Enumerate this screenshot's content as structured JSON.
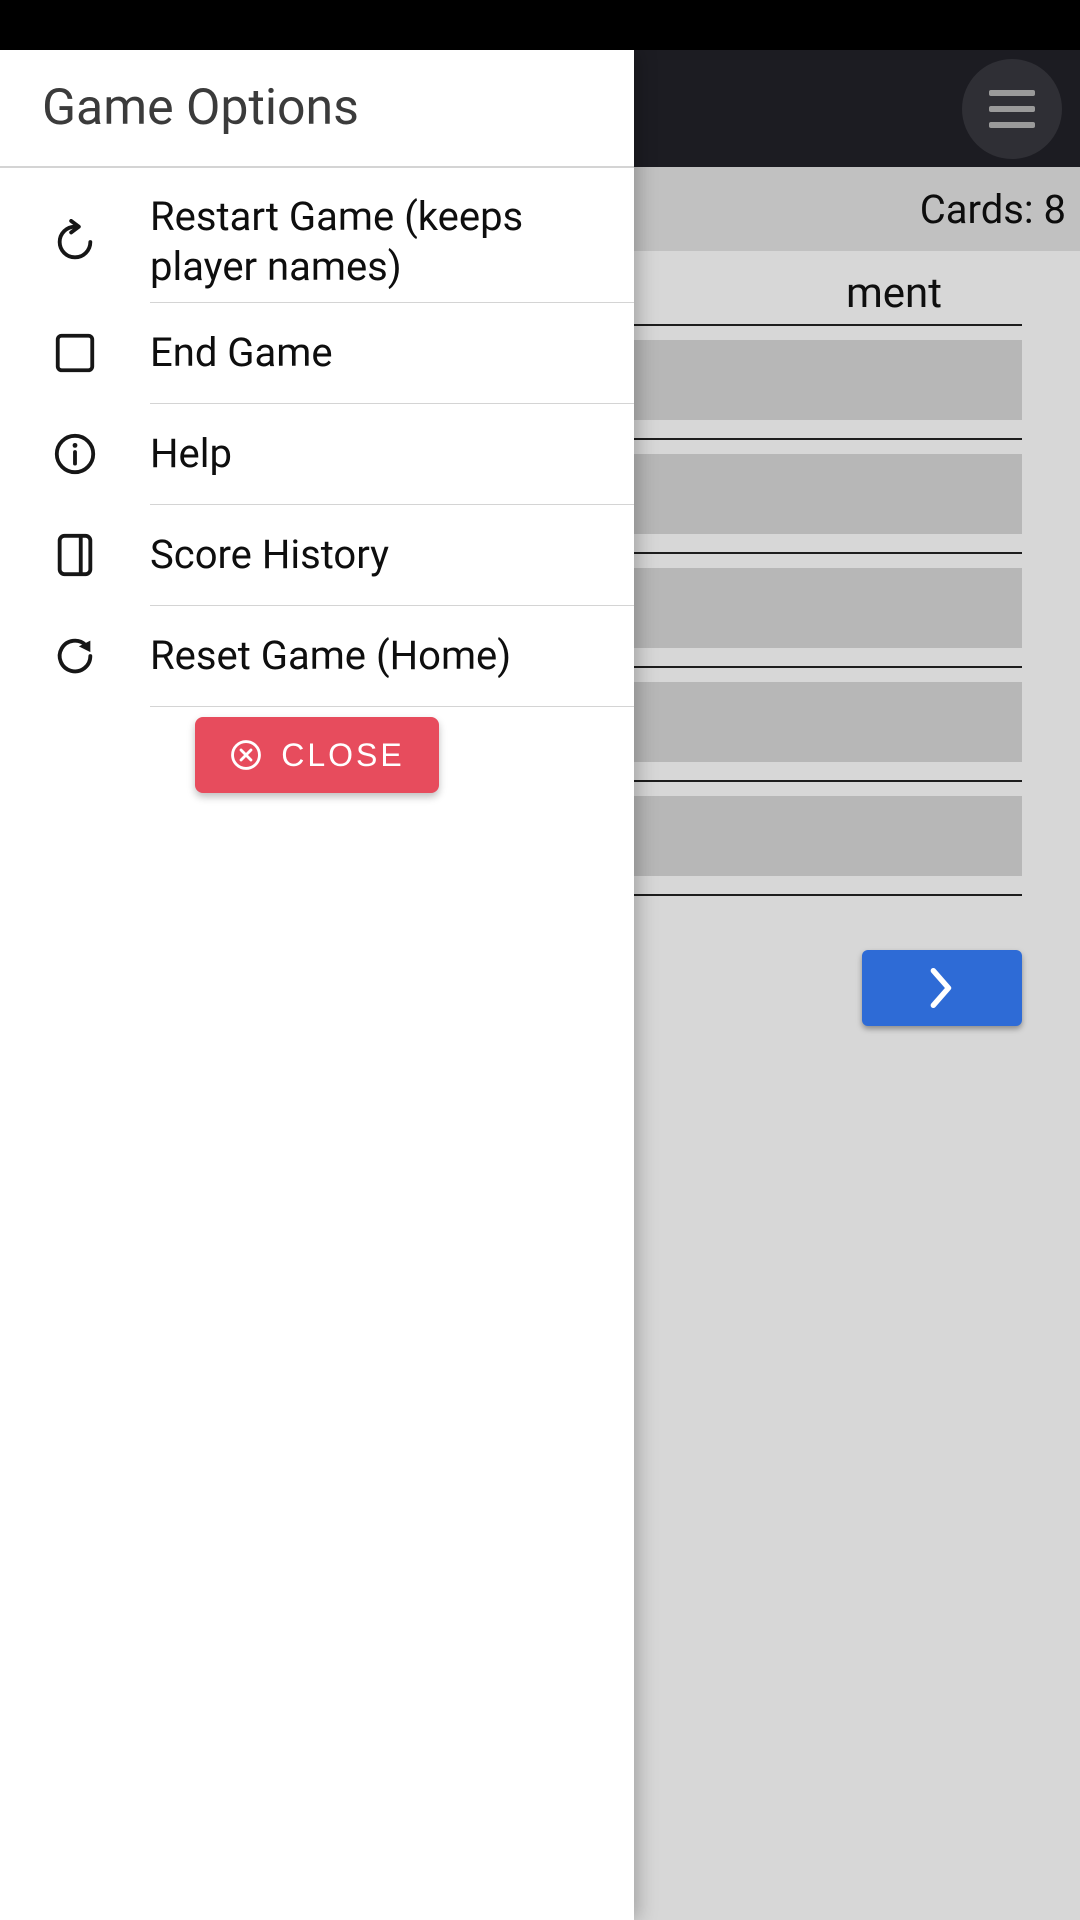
{
  "drawer": {
    "title": "Game Options",
    "items": [
      {
        "label": "Restart Game (keeps player names)",
        "icon": "refresh-icon"
      },
      {
        "label": "End Game",
        "icon": "stop-icon"
      },
      {
        "label": "Help",
        "icon": "info-icon"
      },
      {
        "label": "Score History",
        "icon": "history-card-icon"
      },
      {
        "label": "Reset Game (Home)",
        "icon": "reset-icon"
      }
    ],
    "close_label": "CLOSE"
  },
  "background": {
    "cards_label": "Cards: 8",
    "heading_fragment": "ment"
  }
}
